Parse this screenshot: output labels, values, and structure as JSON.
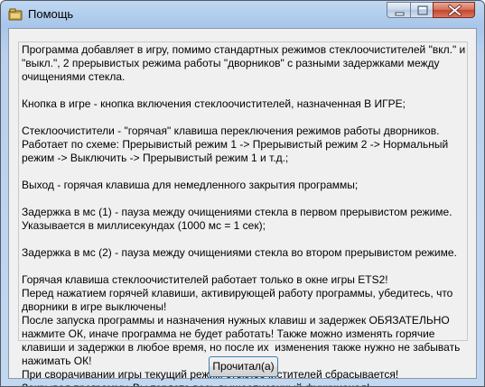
{
  "window": {
    "title": "Помощь",
    "controls": {
      "minimize_icon": "minimize-icon",
      "maximize_icon": "maximize-icon",
      "close_icon": "close-icon"
    }
  },
  "help_text": {
    "paragraphs": [
      "Программа добавляет в игру, помимо стандартных режимов стеклоочистителей \"вкл.\" и \"выкл.\", 2 прерывистых режима работы \"дворников\" с разными задержками между очищениями стекла.",
      "Кнопка в игре - кнопка включения стеклоочистителей, назначенная В ИГРЕ;",
      "Стеклоочистители - \"горячая\" клавиша переключения режимов работы дворников. Работает по схеме: Прерывистый режим 1 -> Прерывистый режим 2 -> Нормальный режим -> Выключить -> Прерывистый режим 1 и т.д.;",
      "Выход - горячая клавиша для немедленного закрытия программы;",
      "Задержка в мс (1) - пауза между очищениями стекла в первом прерывистом режиме.\nУказывается в миллисекундах (1000 мс = 1 сек);",
      "Задержка в мс (2) - пауза между очищениями стекла во втором прерывистом режиме.",
      "Горячая клавиша стеклоочистителей работает только в окне игры ETS2!\nПеред нажатием горячей клавиши, активирующей работу программы, убедитесь, что дворники в игре выключены!\nПосле запуска программы и назначения нужных клавиш и задержек ОБЯЗАТЕЛЬНО нажмите ОК, иначе программа не будет работать! Также можно изменять горячие клавиши и задержки в любое время, но после их  изменения также нужно не забывать нажимать ОК!\nПри сворачивании игры текущий режим стеклоочистителей сбрасывается!\nЗакрывая программу, Вы теряете весь вышеописанный функционал!"
    ]
  },
  "ok_button": {
    "label": "Прочитал(а)"
  },
  "colors": {
    "title_bar": "#a8c6ea",
    "close_button": "#c4452b",
    "dialog_background": "#f0f0f0",
    "button_border": "#3c7fb1"
  }
}
